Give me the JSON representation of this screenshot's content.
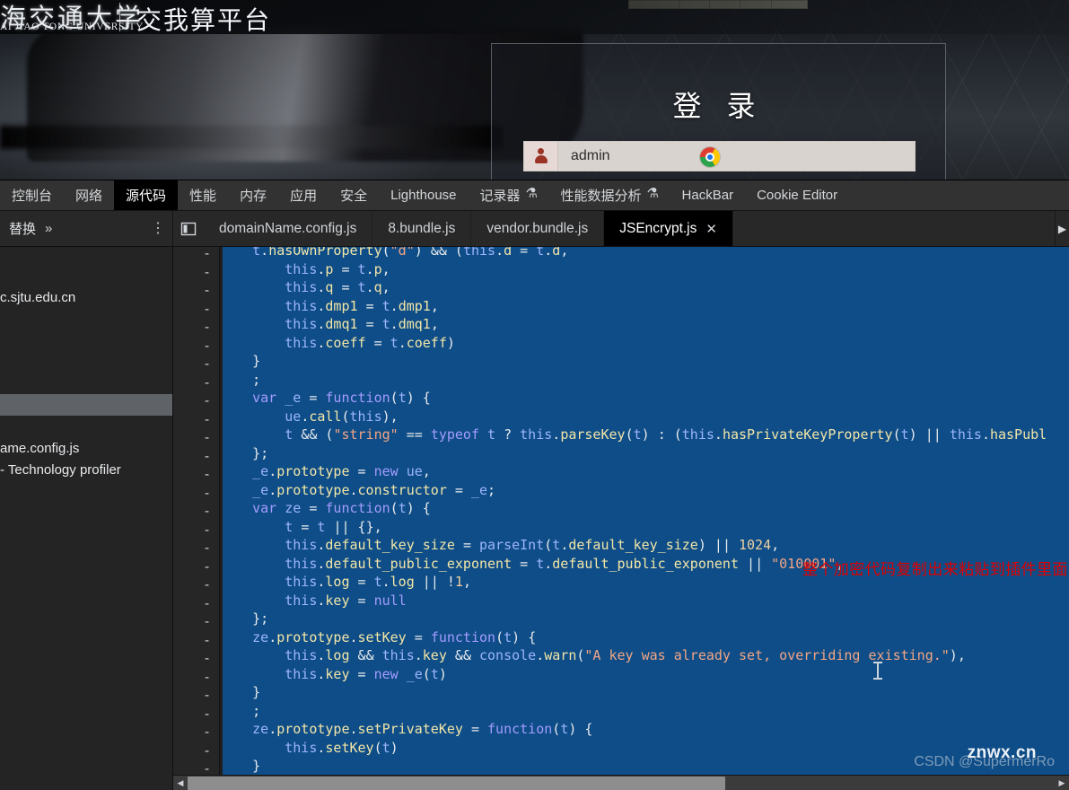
{
  "webpage": {
    "brand_cn": "海交通大学",
    "brand_en": "AI JIAO TONG UNIVERSITY",
    "site_title": "交我算平台",
    "login": {
      "title": "登 录",
      "username_value": "admin",
      "username_placeholder": "admin",
      "user_icon": "person-icon",
      "browser_icon": "chrome-icon"
    }
  },
  "devtools": {
    "panel_tabs": [
      {
        "label": "控制台",
        "active": false,
        "icon": ""
      },
      {
        "label": "网络",
        "active": false,
        "icon": ""
      },
      {
        "label": "源代码",
        "active": true,
        "icon": ""
      },
      {
        "label": "性能",
        "active": false,
        "icon": ""
      },
      {
        "label": "内存",
        "active": false,
        "icon": ""
      },
      {
        "label": "应用",
        "active": false,
        "icon": ""
      },
      {
        "label": "安全",
        "active": false,
        "icon": ""
      },
      {
        "label": "Lighthouse",
        "active": false,
        "icon": ""
      },
      {
        "label": "记录器",
        "active": false,
        "icon": "flask-icon"
      },
      {
        "label": "性能数据分析",
        "active": false,
        "icon": "flask-icon"
      },
      {
        "label": "HackBar",
        "active": false,
        "icon": ""
      },
      {
        "label": "Cookie Editor",
        "active": false,
        "icon": ""
      }
    ],
    "nav_pane": {
      "label": "替换",
      "chevron": "»",
      "more": "⋮"
    },
    "file_tabs": [
      {
        "label": "domainName.config.js",
        "active": false,
        "closable": false
      },
      {
        "label": "8.bundle.js",
        "active": false,
        "closable": false
      },
      {
        "label": "vendor.bundle.js",
        "active": false,
        "closable": false
      },
      {
        "label": "JSEncrypt.js",
        "active": true,
        "closable": true,
        "close": "✕"
      }
    ],
    "tabs_overflow": "▶",
    "navigator_rows": [
      {
        "text": "",
        "selected": false
      },
      {
        "text": "c.sjtu.edu.cn",
        "selected": false
      },
      {
        "text": "",
        "selected": false
      },
      {
        "text": "",
        "selected": false
      },
      {
        "text": "",
        "selected": false
      },
      {
        "text": "",
        "selected": false
      },
      {
        "text": "",
        "selected": true
      },
      {
        "text": "",
        "selected": false
      },
      {
        "text": "ame.config.js",
        "selected": false
      },
      {
        "text": "- Technology profiler",
        "selected": false
      }
    ],
    "gutter_marker": "-",
    "gutter_marker_count": 29,
    "annotation": "整个加密代码复制出来粘贴到插件里面",
    "code_lines": [
      "    t.hasOwnProperty(\"d\") && (this.d = t.d,",
      "        this.p = t.p,",
      "        this.q = t.q,",
      "        this.dmp1 = t.dmp1,",
      "        this.dmq1 = t.dmq1,",
      "        this.coeff = t.coeff)",
      "    }",
      "    ;",
      "    var _e = function(t) {",
      "        ue.call(this),",
      "        t && (\"string\" == typeof t ? this.parseKey(t) : (this.hasPrivateKeyProperty(t) || this.hasPubl",
      "    };",
      "    _e.prototype = new ue,",
      "    _e.prototype.constructor = _e;",
      "    var ze = function(t) {",
      "        t = t || {},",
      "        this.default_key_size = parseInt(t.default_key_size) || 1024,",
      "        this.default_public_exponent = t.default_public_exponent || \"010001\",",
      "        this.log = t.log || !1,",
      "        this.key = null",
      "    };",
      "    ze.prototype.setKey = function(t) {",
      "        this.log && this.key && console.warn(\"A key was already set, overriding existing.\"),",
      "        this.key = new _e(t)",
      "    }",
      "    ;",
      "    ze.prototype.setPrivateKey = function(t) {",
      "        this.setKey(t)",
      "    }"
    ],
    "scroll": {
      "left_arrow": "◀",
      "right_arrow": "▶"
    }
  },
  "watermarks": {
    "csdn": "CSDN @SupermerRo",
    "site": "znwx.cn"
  },
  "colors": {
    "selection_blue": "#0e4d87",
    "annotation_red": "#e00000",
    "active_tab_bg": "#000000",
    "devtools_bg": "#202124"
  }
}
